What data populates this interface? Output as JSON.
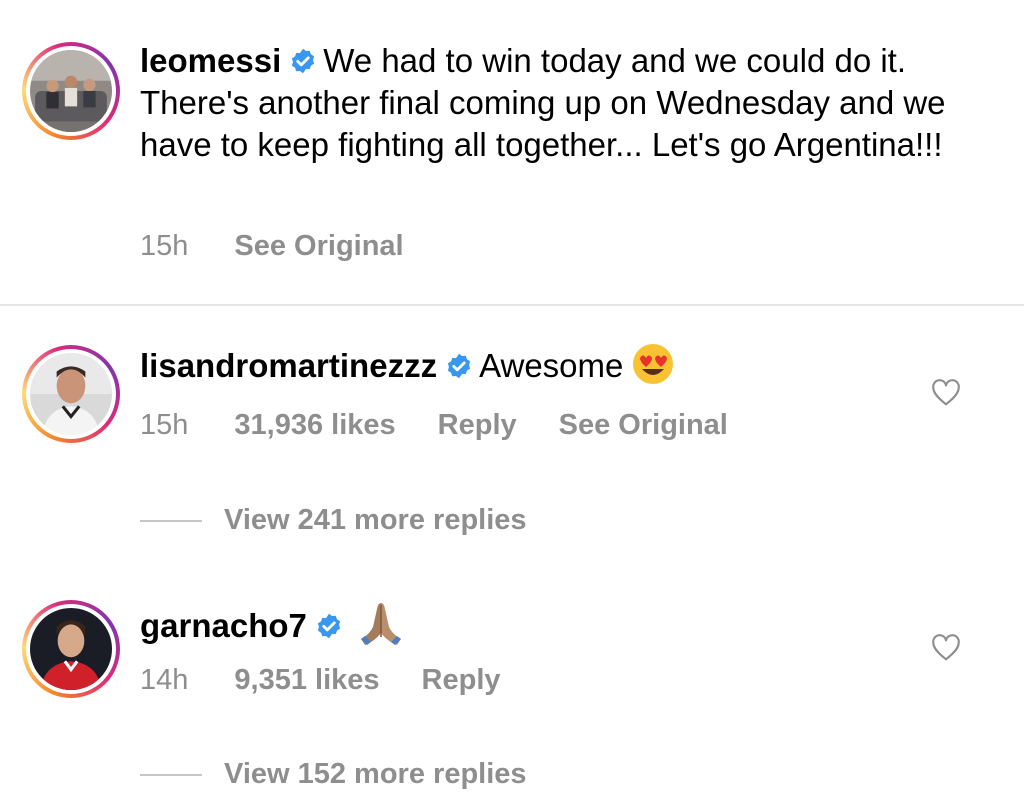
{
  "post": {
    "username": "leomessi",
    "caption": "We had to win today and we could do it. There's another final coming up on Wednesday and we have to keep fighting all together... Let's go Argentina!!!",
    "time": "15h",
    "see_original": "See Original"
  },
  "comments": [
    {
      "username": "lisandromartinezzz",
      "text": "Awesome",
      "emoji": "heart-eyes-emoji",
      "time": "15h",
      "likes": "31,936 likes",
      "reply": "Reply",
      "see_original": "See Original",
      "view_replies": "View 241 more replies"
    },
    {
      "username": "garnacho7",
      "text": "",
      "emoji": "folded-hands-emoji",
      "time": "14h",
      "likes": "9,351 likes",
      "reply": "Reply",
      "view_replies": "View 152 more replies"
    }
  ],
  "colors": {
    "meta_text": "#8e8e8e",
    "verified_blue": "#3897f0",
    "divider": "#e6e6e6"
  }
}
